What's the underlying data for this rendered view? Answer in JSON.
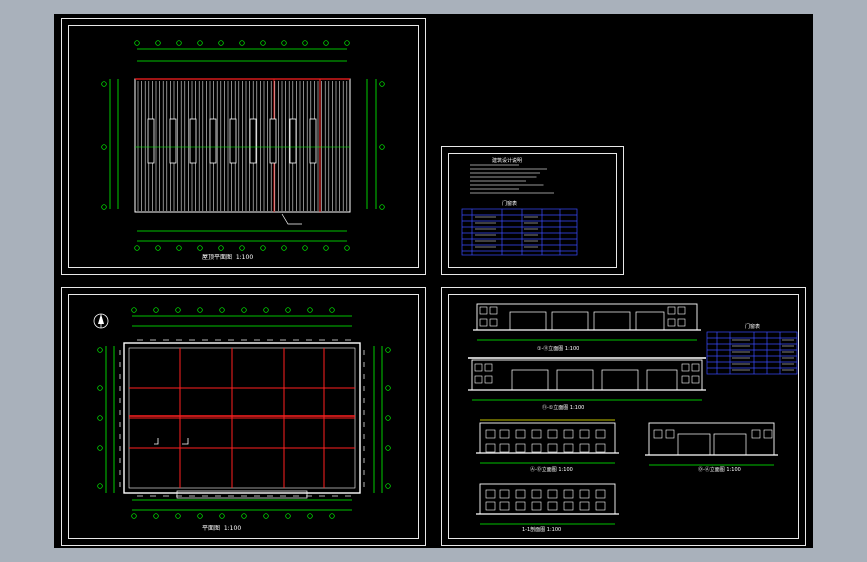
{
  "drawing": {
    "background_color": "#000000",
    "ui_color": "#a9b1bb",
    "line_colors": {
      "frame": "#e8e8e8",
      "axis": "#ff2020",
      "dimension": "#00ff00",
      "wall": "#ffffff",
      "table": "#3a4cff",
      "text": "#ffff00"
    }
  },
  "sheets": {
    "roof_plan": {
      "title": "屋顶平面图",
      "scale": "1:100"
    },
    "notes": {
      "heading": "建筑设计说明",
      "table_heading": "门窗表"
    },
    "floor_plan": {
      "title": "平面图",
      "scale": "1:100"
    },
    "elevations": {
      "elevation_1": {
        "title": "①-⑪立面图",
        "scale": "1:100"
      },
      "elevation_2": {
        "title": "⑪-①立面图",
        "scale": "1:100"
      },
      "elevation_3": {
        "title": "Ⓐ-Ⓓ立面图",
        "scale": "1:100"
      },
      "elevation_4": {
        "title": "Ⓓ-Ⓐ立面图",
        "scale": "1:100"
      },
      "section": {
        "title": "1-1剖面图",
        "scale": "1:100"
      },
      "door_window_table": {
        "heading": "门窗表"
      }
    }
  }
}
